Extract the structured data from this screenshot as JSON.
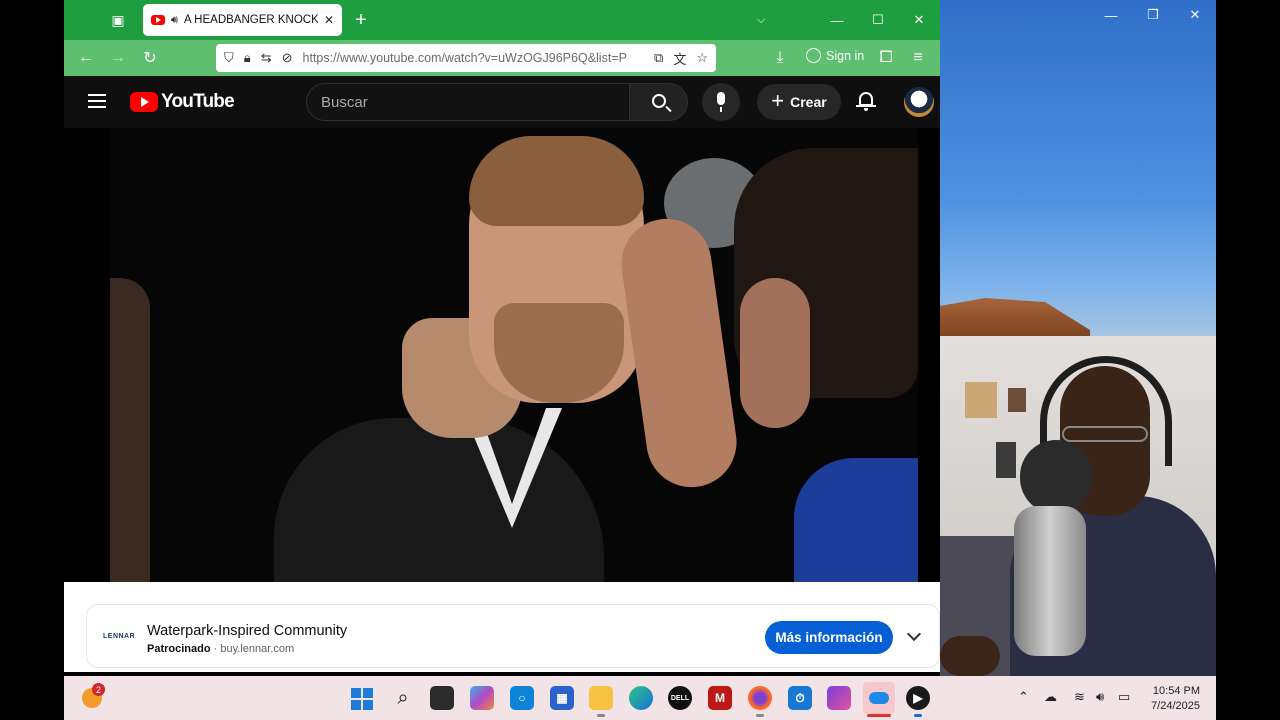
{
  "browser": {
    "tab_title": "A HEADBANGER KNOCKOUT",
    "url": "https://www.youtube.com/watch?v=uWzOGJ96P6Q&list=P",
    "sign_in_label": "Sign in"
  },
  "youtube": {
    "logo_text": "YouTube",
    "search_placeholder": "Buscar",
    "create_label": "Crear"
  },
  "ad": {
    "brand_logo": "LENNAR",
    "title": "Waterpark-Inspired Community",
    "sponsored_label": "Patrocinado",
    "separator": "·",
    "domain": "buy.lennar.com",
    "cta_label": "Más información",
    "cta_color": "#065fd4"
  },
  "taskbar": {
    "weather_badge": "2",
    "time": "10:54 PM",
    "date": "7/24/2025",
    "pinned": [
      "start-icon",
      "search-icon",
      "file-explorer-icon",
      "copilot-icon",
      "cortana-icon",
      "store-icon",
      "folder-icon",
      "edge-icon",
      "dell-icon",
      "mcafee-icon",
      "firefox-icon",
      "alarm-icon",
      "clipchamp-icon",
      "onedrive-icon",
      "obs-icon"
    ]
  },
  "colors": {
    "tabbar": "#1f9e3f",
    "navbar": "#5dbf6f",
    "youtube_header": "#0f0f0f",
    "youtube_red": "#ff0000"
  }
}
